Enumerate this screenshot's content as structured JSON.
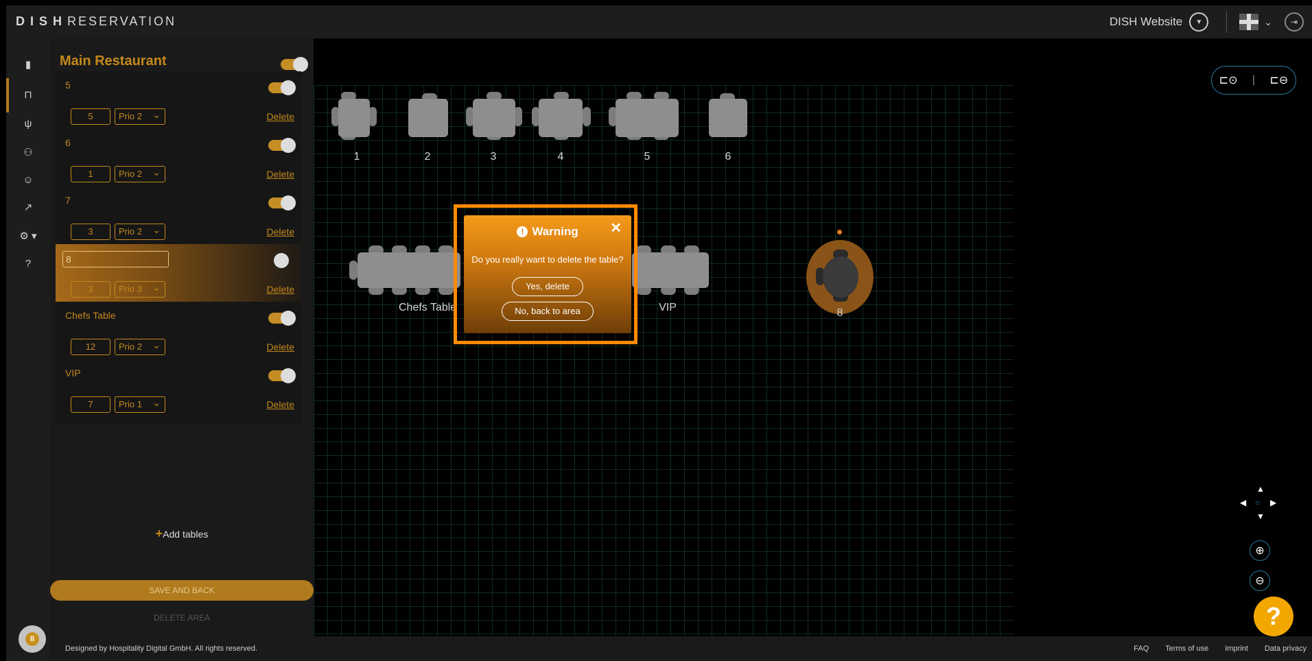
{
  "brand": {
    "prefix": "DISH",
    "suffix": "RESERVATION"
  },
  "topbar": {
    "website_link": "DISH Website"
  },
  "rail": {
    "icons": [
      "book-icon",
      "table-icon",
      "cutlery-icon",
      "guests-icon",
      "smiley-icon",
      "chart-icon",
      "gear-icon",
      "help-icon"
    ]
  },
  "panel": {
    "title": "Main Restaurant",
    "tables": [
      {
        "name": "5",
        "seats": "5",
        "prio": "Prio 2",
        "enabled": true
      },
      {
        "name": "6",
        "seats": "1",
        "prio": "Prio 2",
        "enabled": true
      },
      {
        "name": "7",
        "seats": "3",
        "prio": "Prio 2",
        "enabled": true
      },
      {
        "name": "8",
        "seats": "3",
        "prio": "Prio 3",
        "enabled": false
      },
      {
        "name": "Chefs Table",
        "seats": "12",
        "prio": "Prio 2",
        "enabled": true
      },
      {
        "name": "VIP",
        "seats": "7",
        "prio": "Prio 1",
        "enabled": true
      }
    ],
    "delete_label": "Delete",
    "add_tables": "Add tables",
    "save_button": "SAVE AND BACK",
    "delete_area_button": "DELETE AREA"
  },
  "floor": {
    "labels": [
      "1",
      "2",
      "3",
      "4",
      "5",
      "6",
      "Chefs Table",
      "VIP",
      "8"
    ]
  },
  "modal": {
    "title": "Warning",
    "message": "Do you really want to delete the table?",
    "confirm": "Yes, delete",
    "cancel": "No, back to area"
  },
  "footer": {
    "credit": "Designed by Hospitality Digital GmbH. All rights reserved.",
    "links": [
      "FAQ",
      "Terms of use",
      "Imprint",
      "Data privacy"
    ]
  },
  "help_fab": "?",
  "colors": {
    "accent": "#c4891c",
    "warning": "#ff8a00",
    "background": "#000000"
  }
}
